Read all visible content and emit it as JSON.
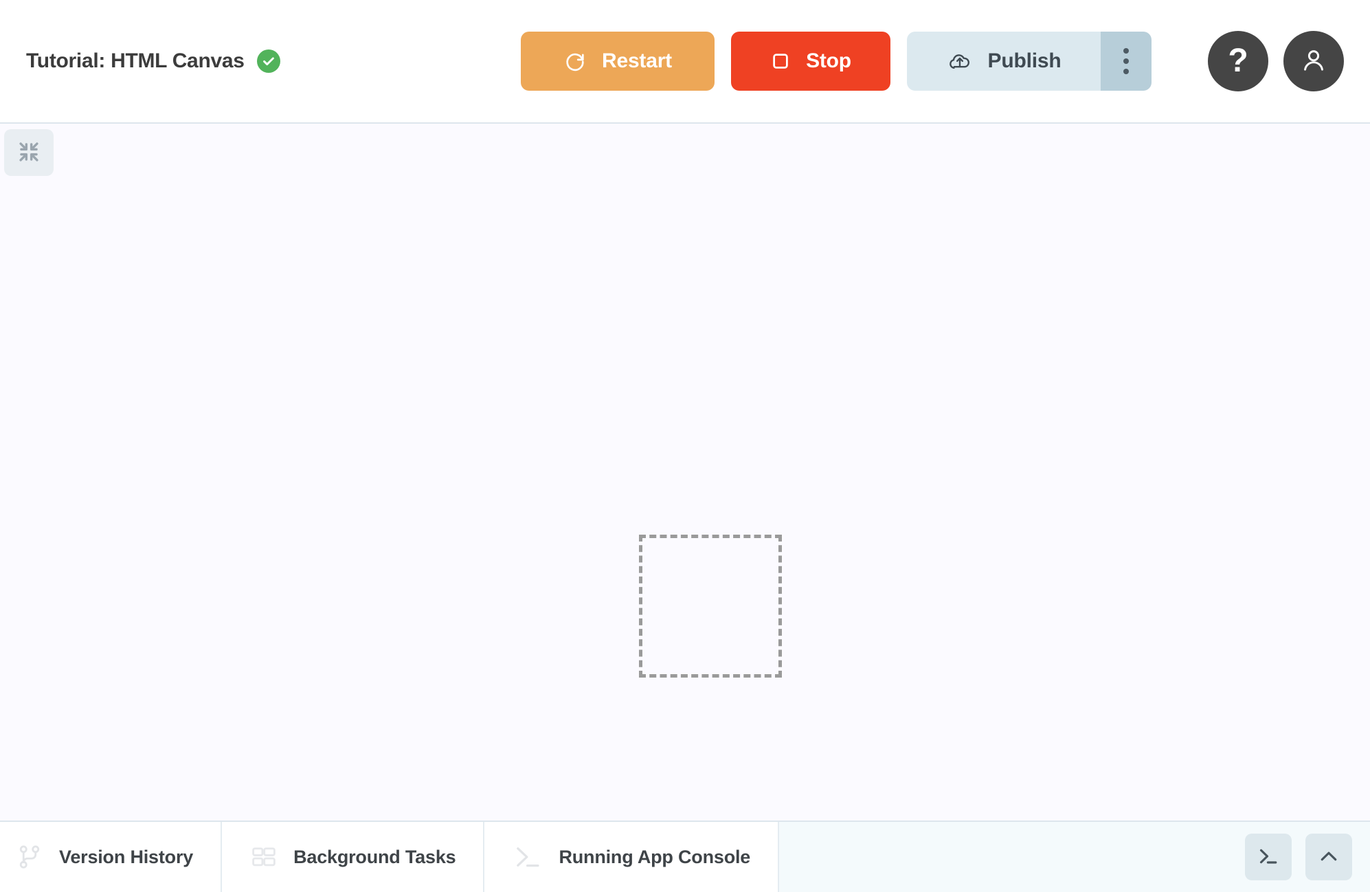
{
  "header": {
    "title": "Tutorial: HTML Canvas",
    "status_icon": "check-circle-icon",
    "status_color": "#52b35b",
    "buttons": {
      "restart": {
        "label": "Restart",
        "icon": "restart-rotate-icon",
        "color": "#eda757"
      },
      "stop": {
        "label": "Stop",
        "icon": "stop-square-icon",
        "color": "#ef4123"
      },
      "publish": {
        "label": "Publish",
        "icon": "cloud-upload-icon",
        "color": "#dce9ef"
      },
      "publish_more": {
        "icon": "more-vertical-icon",
        "color": "#b7ced9"
      }
    },
    "right_buttons": {
      "help": {
        "label": "?",
        "icon": "help-question-icon"
      },
      "account": {
        "icon": "user-avatar-icon"
      }
    }
  },
  "canvas": {
    "collapse_button_icon": "collapse-inward-arrows-icon",
    "background_color": "#fbfaff",
    "placeholder": {
      "name": "empty-canvas-placeholder",
      "border_style": "dashed",
      "border_color": "#9a9a9a"
    }
  },
  "bottom": {
    "tabs": [
      {
        "label": "Version History",
        "icon": "git-branch-icon"
      },
      {
        "label": "Background Tasks",
        "icon": "panels-layout-icon"
      },
      {
        "label": "Running App Console",
        "icon": "terminal-prompt-icon"
      }
    ],
    "right_buttons": [
      {
        "icon": "terminal-prompt-icon",
        "name": "open-terminal-button"
      },
      {
        "icon": "chevron-up-icon",
        "name": "expand-panel-button"
      }
    ]
  }
}
